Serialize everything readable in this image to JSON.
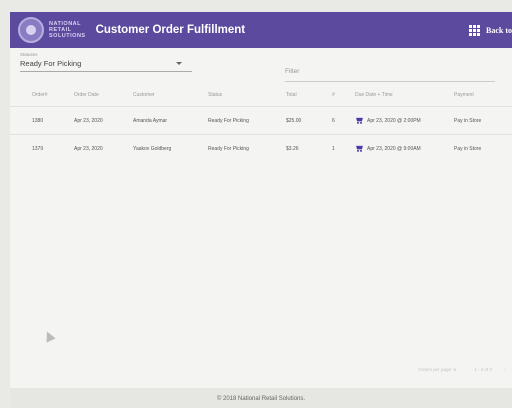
{
  "header": {
    "logo_lines": [
      "NATIONAL",
      "RETAIL",
      "SOLUTIONS"
    ],
    "title": "Customer Order Fulfillment",
    "back_label": "Back to",
    "accent_color": "#5b4a9e"
  },
  "filters": {
    "status_label": "Statuses",
    "status_value": "Ready For Picking",
    "filter_placeholder": "Filter"
  },
  "table": {
    "columns": [
      "Order#",
      "Order Date",
      "Customer",
      "Status",
      "Total",
      "#",
      "Due Date + Time",
      "Payment"
    ],
    "rows": [
      [
        "1380",
        "Apr 23, 2020",
        "Amanda Aymar",
        "Ready For Picking",
        "$25.00",
        "6",
        "Apr 23, 2020 @ 2:00PM",
        "Pay in Store"
      ],
      [
        "1379",
        "Apr 23, 2020",
        "Yaakov Goldberg",
        "Ready For Picking",
        "$3.26",
        "1",
        "Apr 23, 2020 @ 9:00AM",
        "Pay in Store"
      ]
    ],
    "due_icon": "shopping-cart-icon"
  },
  "pager": {
    "rows_per_page": "Orders per page: 5",
    "range": "1 - 2 of 2"
  },
  "footer": {
    "text": "© 2018 National Retail Solutions."
  }
}
